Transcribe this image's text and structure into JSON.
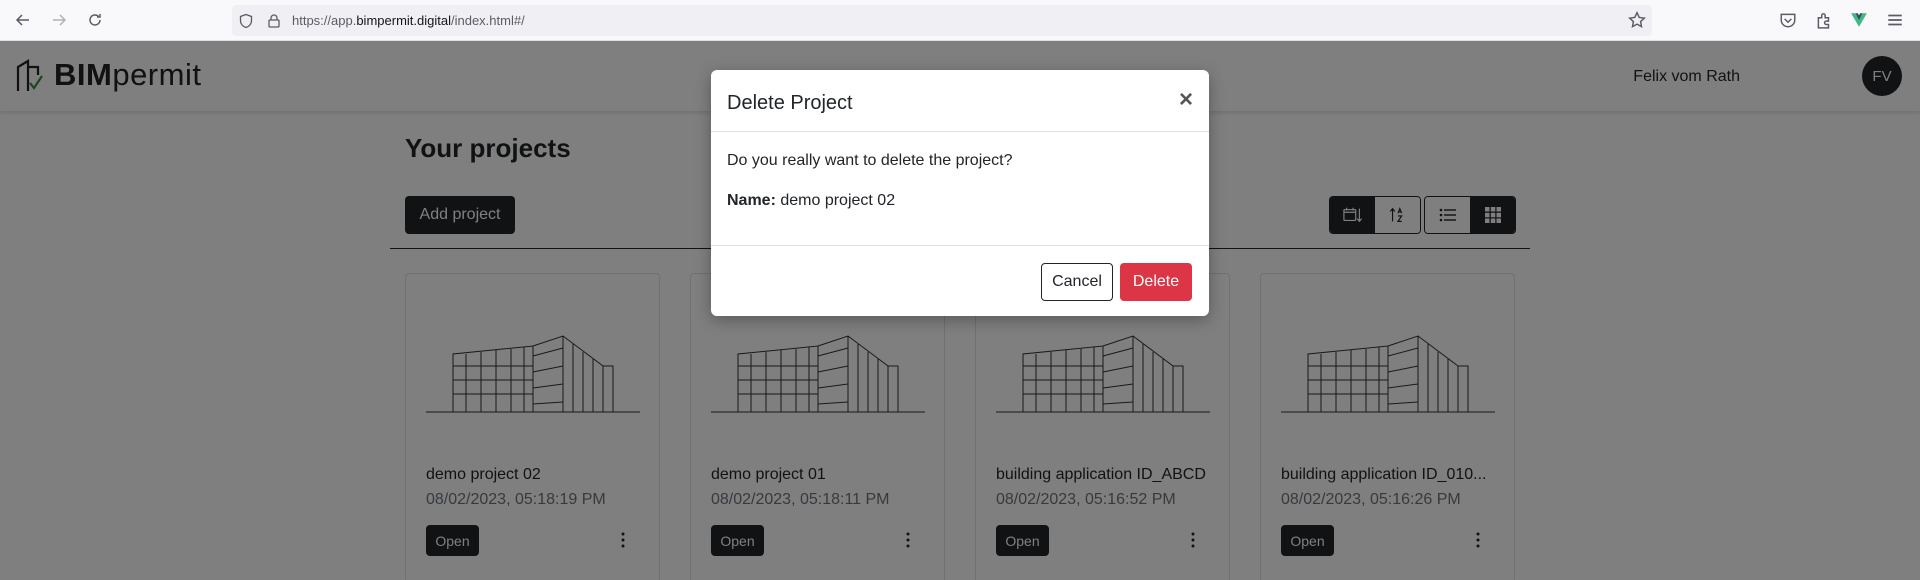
{
  "browser": {
    "url_prefix": "https://app.",
    "url_host": "bimpermit.digital",
    "url_path": "/index.html#/"
  },
  "header": {
    "logo_bold": "BIM",
    "logo_light": "permit",
    "user_name": "Felix vom Rath",
    "avatar_initials": "FV"
  },
  "main": {
    "title": "Your projects",
    "add_button": "Add project"
  },
  "projects": [
    {
      "name": "demo project 02",
      "date": "08/02/2023, 05:18:19 PM",
      "open_label": "Open"
    },
    {
      "name": "demo project 01",
      "date": "08/02/2023, 05:18:11 PM",
      "open_label": "Open"
    },
    {
      "name": "building application ID_ABCD",
      "date": "08/02/2023, 05:16:52 PM",
      "open_label": "Open"
    },
    {
      "name": "building application ID_010...",
      "date": "08/02/2023, 05:16:26 PM",
      "open_label": "Open"
    }
  ],
  "modal": {
    "title": "Delete Project",
    "close_symbol": "×",
    "question": "Do you really want to delete the project?",
    "name_label": "Name:",
    "name_value": "demo project 02",
    "cancel_label": "Cancel",
    "delete_label": "Delete"
  },
  "colors": {
    "primary_dark": "#212529",
    "danger": "#dc3545",
    "overlay": "rgba(0,0,0,0.5)"
  }
}
